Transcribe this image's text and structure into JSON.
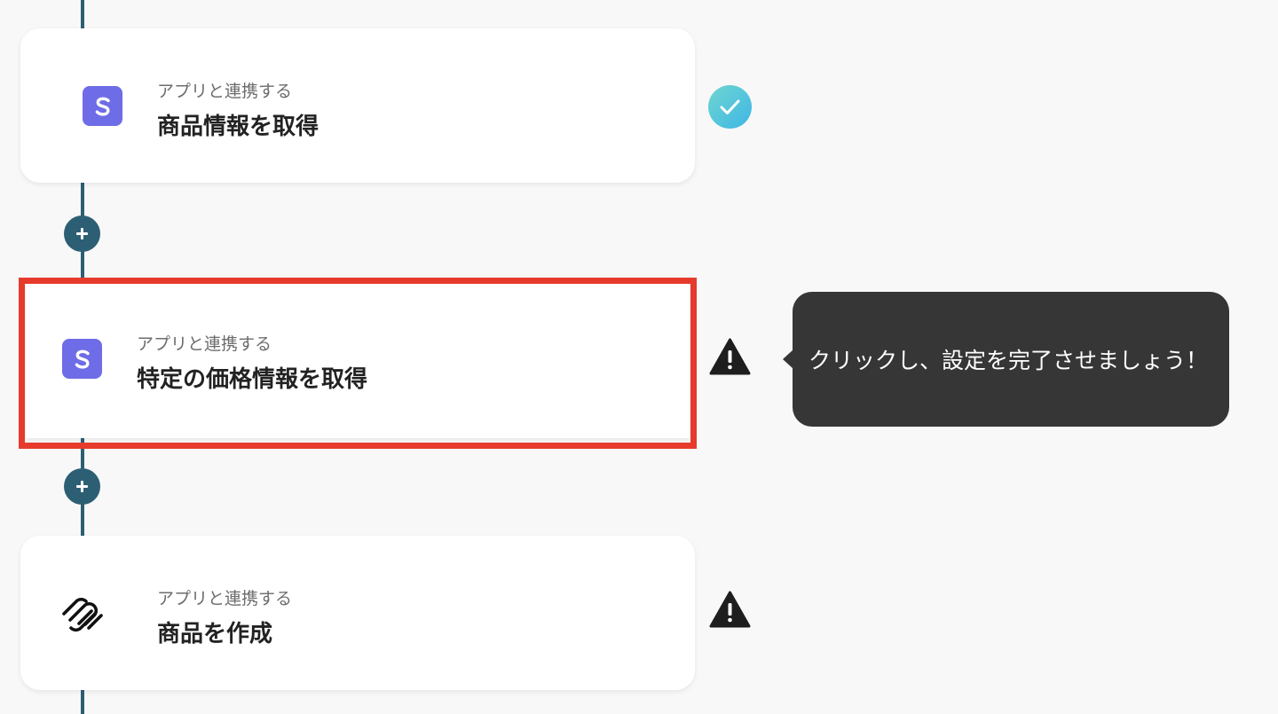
{
  "colors": {
    "background": "#f8f8f8",
    "connector": "#2c5f74",
    "stripe_brand": "#6e6ce6",
    "highlight": "#e63b2c",
    "tooltip_bg": "#363636",
    "complete": "#4cc3dd"
  },
  "steps": [
    {
      "subtitle": "アプリと連携する",
      "title": "商品情報を取得",
      "app_icon": "stripe-icon",
      "status": "complete",
      "status_icon": "check-circle-icon"
    },
    {
      "subtitle": "アプリと連携する",
      "title": "特定の価格情報を取得",
      "app_icon": "stripe-icon",
      "status": "incomplete",
      "status_icon": "warning-icon",
      "highlighted": true
    },
    {
      "subtitle": "アプリと連携する",
      "title": "商品を作成",
      "app_icon": "squarespace-icon",
      "status": "incomplete",
      "status_icon": "warning-icon"
    }
  ],
  "add_step_icon": "plus-icon",
  "tooltip": {
    "text": "クリックし、設定を完了させましょう！"
  }
}
